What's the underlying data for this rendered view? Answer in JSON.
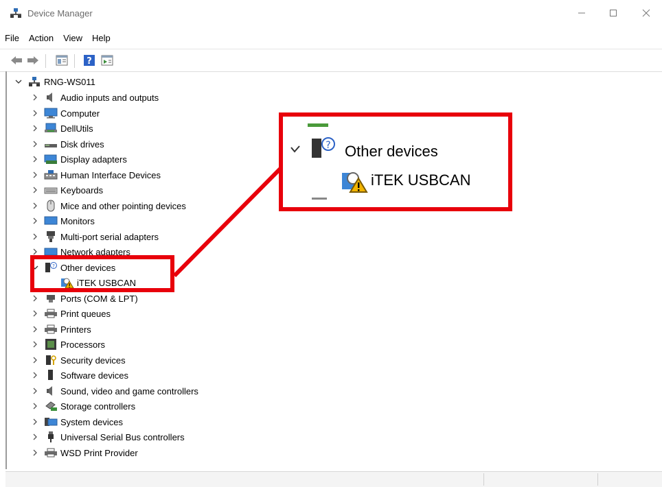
{
  "window": {
    "title": "Device Manager"
  },
  "menu": [
    "File",
    "Action",
    "View",
    "Help"
  ],
  "tree": {
    "root": "RNG-WS011",
    "categories": [
      {
        "label": "Audio inputs and outputs",
        "icon": "speaker-icon"
      },
      {
        "label": "Computer",
        "icon": "computer-icon"
      },
      {
        "label": "DellUtils",
        "icon": "dellutils-icon"
      },
      {
        "label": "Disk drives",
        "icon": "disk-drive-icon"
      },
      {
        "label": "Display adapters",
        "icon": "display-adapter-icon"
      },
      {
        "label": "Human Interface Devices",
        "icon": "hid-icon"
      },
      {
        "label": "Keyboards",
        "icon": "keyboard-icon"
      },
      {
        "label": "Mice and other pointing devices",
        "icon": "mouse-icon"
      },
      {
        "label": "Monitors",
        "icon": "monitor-icon"
      },
      {
        "label": "Multi-port serial adapters",
        "icon": "serial-adapter-icon"
      },
      {
        "label": "Network adapters",
        "icon": "network-adapter-icon"
      },
      {
        "label": "Other devices",
        "icon": "unknown-device-icon",
        "expanded": true
      },
      {
        "label": "iTEK USBCAN",
        "icon": "warning-device-icon",
        "child": true
      },
      {
        "label": "Ports (COM & LPT)",
        "icon": "port-icon"
      },
      {
        "label": "Print queues",
        "icon": "printer-icon"
      },
      {
        "label": "Printers",
        "icon": "printer-icon"
      },
      {
        "label": "Processors",
        "icon": "processor-icon"
      },
      {
        "label": "Security devices",
        "icon": "security-device-icon"
      },
      {
        "label": "Software devices",
        "icon": "software-device-icon"
      },
      {
        "label": "Sound, video and game controllers",
        "icon": "speaker-icon"
      },
      {
        "label": "Storage controllers",
        "icon": "storage-controller-icon"
      },
      {
        "label": "System devices",
        "icon": "system-device-icon"
      },
      {
        "label": "Universal Serial Bus controllers",
        "icon": "usb-icon"
      },
      {
        "label": "WSD Print Provider",
        "icon": "printer-icon"
      }
    ]
  },
  "callout": {
    "category": "Other devices",
    "device": "iTEK USBCAN",
    "color": "#e8000b"
  }
}
